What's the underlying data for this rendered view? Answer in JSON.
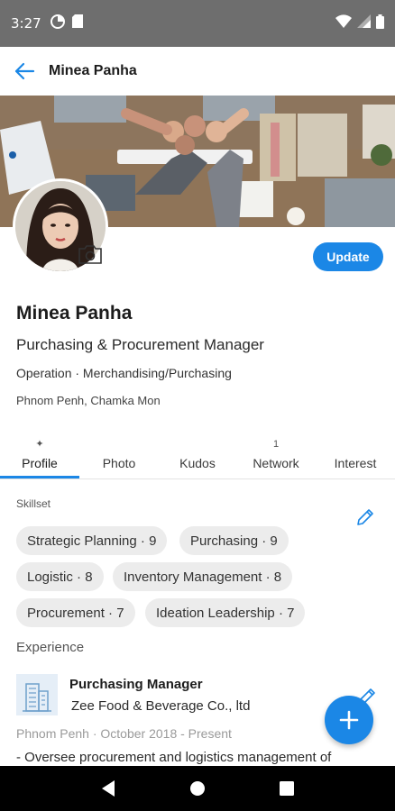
{
  "status_bar": {
    "time": "3:27",
    "left_icons": [
      "data-saver-icon",
      "sd-card-icon"
    ],
    "right_icons": [
      "wifi-icon",
      "signal-icon",
      "battery-icon"
    ]
  },
  "app_bar": {
    "title": "Minea Panha",
    "back_icon": "arrow-left-icon",
    "accent_color": "#1b87e6"
  },
  "profile": {
    "name": "Minea Panha",
    "title": "Purchasing & Procurement Manager",
    "department": "Operation · Merchandising/Purchasing",
    "location": "Phnom Penh, Chamka Mon",
    "update_label": "Update"
  },
  "tabs": [
    {
      "label": "Profile",
      "marker": "✦",
      "active": true
    },
    {
      "label": "Photo",
      "marker": "",
      "active": false
    },
    {
      "label": "Kudos",
      "marker": "",
      "active": false
    },
    {
      "label": "Network",
      "marker": "1",
      "active": false
    },
    {
      "label": "Interest",
      "marker": "",
      "active": false
    }
  ],
  "skillset": {
    "label": "Skillset",
    "skills": [
      "Strategic Planning · 9",
      "Purchasing  · 9",
      "Logistic · 8",
      "Inventory Management · 8",
      "Procurement · 7",
      "Ideation Leadership · 7"
    ]
  },
  "experience": {
    "label": "Experience",
    "items": [
      {
        "role": "Purchasing Manager",
        "company": "Zee Food & Beverage Co., ltd",
        "location": "Phnom Penh",
        "period": "October 2018 - Present",
        "description": "- Oversee procurement and logistics management of"
      }
    ]
  },
  "fab_icon": "plus-icon",
  "nav_bar": [
    "back-triangle-icon",
    "home-circle-icon",
    "recents-square-icon"
  ]
}
